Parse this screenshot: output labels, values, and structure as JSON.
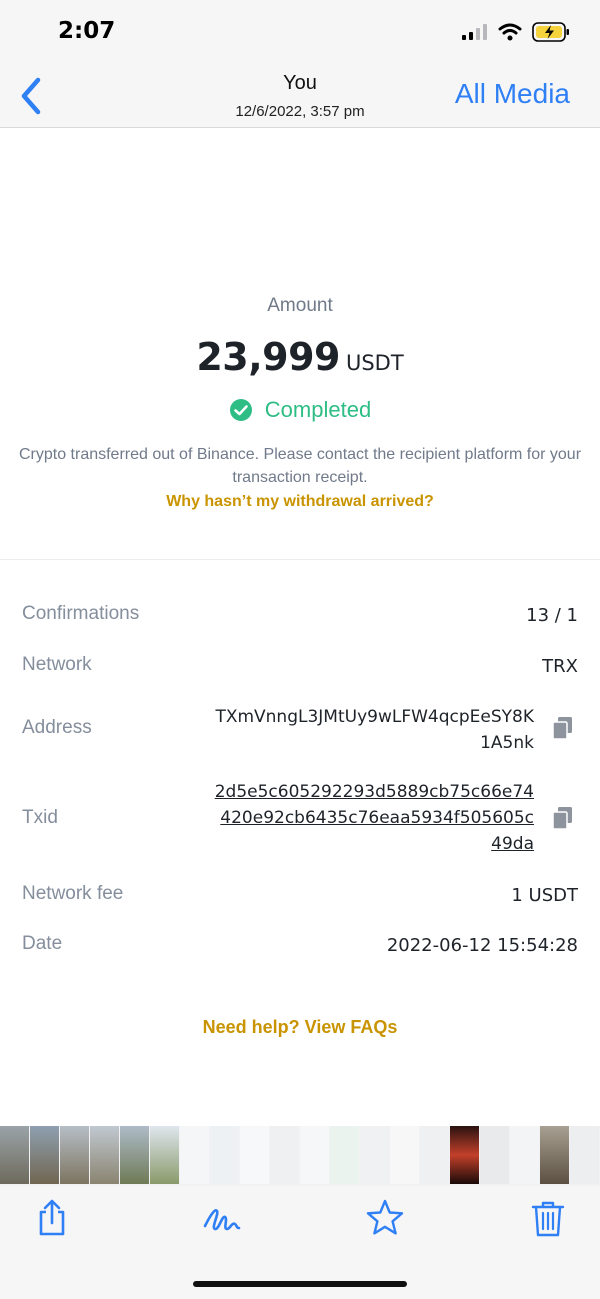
{
  "status_bar": {
    "time": "2:07"
  },
  "nav": {
    "title": "You",
    "subtitle": "12/6/2022, 3:57 pm",
    "all_media": "All Media",
    "accent_color": "#2f7ff5"
  },
  "transaction": {
    "amount_label": "Amount",
    "amount_value": "23,999",
    "amount_unit": "USDT",
    "status": "Completed",
    "status_color": "#2ebd85",
    "notice": "Crypto transferred out of Binance. Please contact the recipient platform for your transaction receipt.",
    "notice_link": "Why hasn’t my withdrawal arrived?",
    "link_color": "#c99400"
  },
  "details": {
    "confirmations_label": "Confirmations",
    "confirmations_value": "13 / 1",
    "network_label": "Network",
    "network_value": "TRX",
    "address_label": "Address",
    "address_value": "TXmVnngL3JMtUy9wLFW4qcpEeSY8K1A5nk",
    "txid_label": "Txid",
    "txid_value": "2d5e5c605292293d5889cb75c66e74420e92cb6435c76eaa5934f505605c49da",
    "fee_label": "Network fee",
    "fee_value": "1 USDT",
    "date_label": "Date",
    "date_value": "2022-06-12 15:54:28"
  },
  "help": {
    "label": "Need help? View FAQs"
  },
  "icons": {
    "back": "chevron-left-icon",
    "copy": "copy-icon",
    "share": "share-icon",
    "markup": "markup-icon",
    "favorite": "star-icon",
    "delete": "trash-icon"
  }
}
